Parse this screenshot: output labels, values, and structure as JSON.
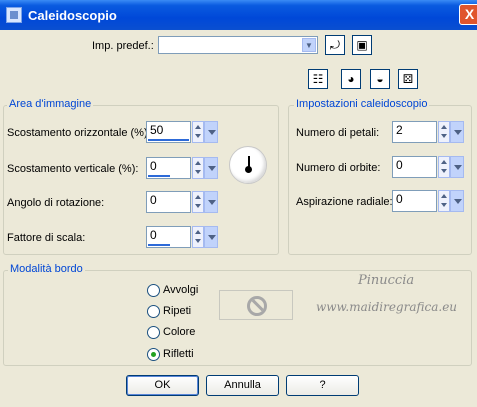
{
  "window": {
    "title": "Caleidoscopio",
    "close_label": "X"
  },
  "preset": {
    "label": "Imp. predef.:",
    "value": ""
  },
  "toolbar_icons": [
    "reset-preview-icon",
    "random-eye-icon",
    "eye-icon",
    "dice-icon"
  ],
  "image_area": {
    "title": "Area d'immagine",
    "fields": [
      {
        "label": "Scostamento orizzontale (%):",
        "value": "50"
      },
      {
        "label": "Scostamento verticale (%):",
        "value": "0"
      },
      {
        "label": "Angolo di rotazione:",
        "value": "0"
      },
      {
        "label": "Fattore di scala:",
        "value": "0"
      }
    ]
  },
  "kaleido": {
    "title": "Impostazioni caleidoscopio",
    "fields": [
      {
        "label": "Numero di petali:",
        "value": "2"
      },
      {
        "label": "Numero di orbite:",
        "value": "0"
      },
      {
        "label": "Aspirazione radiale:",
        "value": "0"
      }
    ]
  },
  "edge": {
    "title": "Modalità bordo",
    "options": [
      {
        "label": "Avvolgi",
        "checked": false
      },
      {
        "label": "Ripeti",
        "checked": false
      },
      {
        "label": "Colore",
        "checked": false
      },
      {
        "label": "Rifletti",
        "checked": true
      }
    ]
  },
  "watermark": {
    "line1": "Pinuccia",
    "line2": "www.maidiregrafica.eu"
  },
  "buttons": {
    "ok": "OK",
    "cancel": "Annulla",
    "help": "?"
  }
}
